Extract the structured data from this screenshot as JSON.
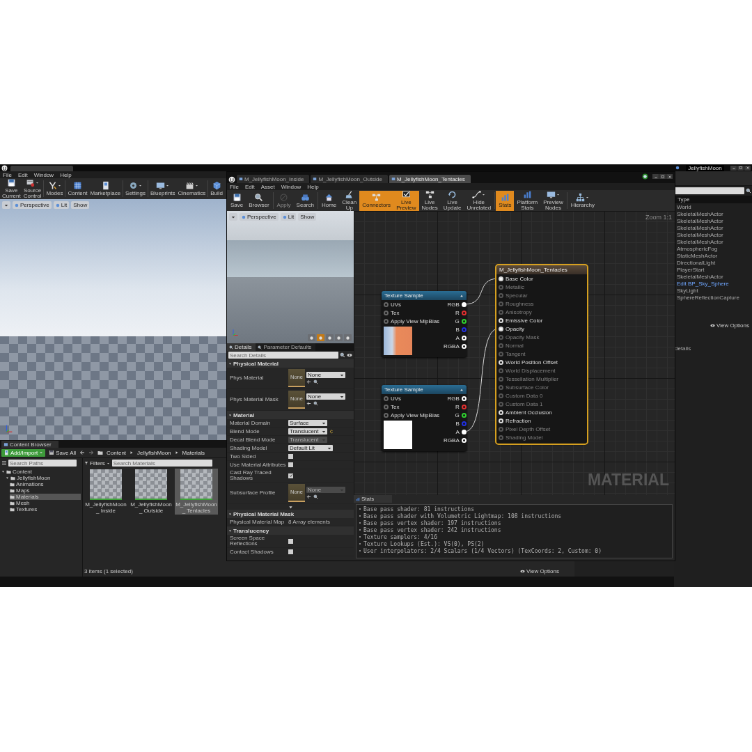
{
  "main_window": {
    "menu": [
      "File",
      "Edit",
      "Window",
      "Help"
    ],
    "toolbar": [
      {
        "label": "Save Current",
        "dropdown": false
      },
      {
        "label": "Source Control",
        "dropdown": true
      },
      {
        "label": "Modes",
        "dropdown": true
      },
      {
        "label": "Content",
        "dropdown": false
      },
      {
        "label": "Marketplace",
        "dropdown": false
      },
      {
        "label": "Settings",
        "dropdown": true
      },
      {
        "label": "Blueprints",
        "dropdown": true
      },
      {
        "label": "Cinematics",
        "dropdown": true
      },
      {
        "label": "Build",
        "dropdown": false
      }
    ],
    "viewport": {
      "view_mode": "Perspective",
      "lighting": "Lit",
      "show": "Show"
    }
  },
  "content_browser": {
    "tab": "Content Browser",
    "add_button": "Add/Import",
    "save_all": "Save All",
    "path": [
      "Content",
      "JellyfishMoon",
      "Materials"
    ],
    "search_paths_placeholder": "Search Paths",
    "tree": [
      {
        "label": "Content",
        "expanded": true,
        "selected": false,
        "children": [
          {
            "label": "JellyfishMoon",
            "expanded": true,
            "selected": false,
            "children": [
              {
                "label": "Animations",
                "selected": false
              },
              {
                "label": "Maps",
                "selected": false
              },
              {
                "label": "Materials",
                "selected": true
              },
              {
                "label": "Mesh",
                "selected": false
              },
              {
                "label": "Textures",
                "selected": false
              }
            ]
          }
        ]
      }
    ],
    "filters": "Filters",
    "search_placeholder": "Search Materials",
    "assets": [
      {
        "name": "M_JellyfishMoon_ Inside",
        "selected": false
      },
      {
        "name": "M_JellyfishMoon_ Outside",
        "selected": false
      },
      {
        "name": "M_JellyfishMoon_ Tentacles",
        "selected": true
      }
    ],
    "status": "3 items (1 selected)",
    "view_options": "View Options"
  },
  "outliner": {
    "tab": "JellyfishMoon",
    "column": "Type",
    "items": [
      {
        "label": "World",
        "kind": "plain"
      },
      {
        "label": "SkeletalMeshActor",
        "kind": "plain"
      },
      {
        "label": "SkeletalMeshActor",
        "kind": "plain"
      },
      {
        "label": "SkeletalMeshActor",
        "kind": "plain"
      },
      {
        "label": "SkeletalMeshActor",
        "kind": "plain"
      },
      {
        "label": "SkeletalMeshActor",
        "kind": "plain"
      },
      {
        "label": "AtmosphericFog",
        "kind": "plain"
      },
      {
        "label": "StaticMeshActor",
        "kind": "plain"
      },
      {
        "label": "DirectionalLight",
        "kind": "plain"
      },
      {
        "label": "PlayerStart",
        "kind": "plain"
      },
      {
        "label": "SkeletalMeshActor",
        "kind": "plain"
      },
      {
        "label": "Edit BP_Sky_Sphere",
        "kind": "link"
      },
      {
        "label": "SkyLight",
        "kind": "plain"
      },
      {
        "label": "SphereReflectionCapture",
        "kind": "plain"
      }
    ],
    "view_options": "View Options"
  },
  "details_panel": {
    "hint": "details"
  },
  "material_editor": {
    "tabs": [
      {
        "label": "M_JellyfishMoon_Inside",
        "selected": false
      },
      {
        "label": "M_JellyfishMoon_Outside",
        "selected": false
      },
      {
        "label": "M_JellyfishMoon_Tentacles",
        "selected": true
      }
    ],
    "menu": [
      "File",
      "Edit",
      "Asset",
      "Window",
      "Help"
    ],
    "toolbar": [
      {
        "label": "Save",
        "active": false,
        "disabled": false,
        "dropdown": false
      },
      {
        "label": "Browser",
        "active": false,
        "disabled": false,
        "dropdown": false
      },
      {
        "label": "Apply",
        "active": false,
        "disabled": true,
        "dropdown": false
      },
      {
        "label": "Search",
        "active": false,
        "disabled": false,
        "dropdown": false
      },
      {
        "label": "Home",
        "active": false,
        "disabled": false,
        "dropdown": false
      },
      {
        "label": "Clean Up",
        "active": false,
        "disabled": false,
        "dropdown": false
      },
      {
        "label": "Connectors",
        "active": true,
        "disabled": false,
        "dropdown": false
      },
      {
        "label": "Live Preview",
        "active": true,
        "disabled": false,
        "dropdown": false
      },
      {
        "label": "Live Nodes",
        "active": false,
        "disabled": false,
        "dropdown": false
      },
      {
        "label": "Live Update",
        "active": false,
        "disabled": false,
        "dropdown": false
      },
      {
        "label": "Hide Unrelated",
        "active": false,
        "disabled": false,
        "dropdown": true
      },
      {
        "label": "Stats",
        "active": true,
        "disabled": false,
        "dropdown": false
      },
      {
        "label": "Platform Stats",
        "active": false,
        "disabled": false,
        "dropdown": false
      },
      {
        "label": "Preview Nodes",
        "active": false,
        "disabled": false,
        "dropdown": true
      },
      {
        "label": "Hierarchy",
        "active": false,
        "disabled": false,
        "dropdown": true
      }
    ],
    "preview": {
      "view_mode": "Perspective",
      "lighting": "Lit",
      "show": "Show"
    },
    "details": {
      "tabs": [
        {
          "label": "Details",
          "selected": true
        },
        {
          "label": "Parameter Defaults",
          "selected": false
        }
      ],
      "search_placeholder": "Search Details",
      "sections": [
        {
          "title": "Physical Material",
          "rows": [
            {
              "kind": "asset",
              "label": "Phys Material",
              "thumb": "None",
              "value": "None",
              "disabled": false
            },
            {
              "kind": "asset",
              "label": "Phys Material Mask",
              "thumb": "None",
              "value": "None",
              "disabled": false
            }
          ]
        },
        {
          "title": "Material",
          "rows": [
            {
              "kind": "combo",
              "label": "Material Domain",
              "value": "Surface",
              "disabled": false,
              "reset": false
            },
            {
              "kind": "combo",
              "label": "Blend Mode",
              "value": "Translucent",
              "disabled": false,
              "reset": true
            },
            {
              "kind": "combo",
              "label": "Decal Blend Mode",
              "value": "Translucent",
              "disabled": true,
              "reset": false
            },
            {
              "kind": "combo",
              "label": "Shading Model",
              "value": "Default Lit",
              "disabled": false,
              "reset": false
            },
            {
              "kind": "check",
              "label": "Two Sided",
              "checked": false
            },
            {
              "kind": "check",
              "label": "Use Material Attributes",
              "checked": false
            },
            {
              "kind": "check",
              "label": "Cast Ray Traced Shadows",
              "checked": true
            },
            {
              "kind": "asset",
              "label": "Subsurface Profile",
              "thumb": "None",
              "value": "None",
              "disabled": true
            },
            {
              "kind": "advanced"
            }
          ]
        },
        {
          "title": "Physical Material Mask",
          "rows": [
            {
              "kind": "array",
              "label": "Physical Material Map",
              "value": "8 Array elements"
            }
          ]
        },
        {
          "title": "Translucency",
          "rows": [
            {
              "kind": "check",
              "label": "Screen Space Reflections",
              "checked": false
            },
            {
              "kind": "check",
              "label": "Contact Shadows",
              "checked": false
            }
          ]
        }
      ]
    },
    "graph": {
      "zoom": "Zoom 1:1",
      "watermark": "MATERIAL",
      "nodes": [
        {
          "kind": "texture",
          "title": "Texture Sample",
          "selected": false,
          "preview": {
            "kind": "image"
          },
          "inputs": [
            "UVs",
            "Tex",
            "Apply View MipBias"
          ],
          "outputs": [
            {
              "label": "RGB",
              "color": "#ffffff",
              "connected": true
            },
            {
              "label": "R",
              "color": "#e03030",
              "connected": false
            },
            {
              "label": "G",
              "color": "#30d030",
              "connected": false
            },
            {
              "label": "B",
              "color": "#2030e0",
              "connected": false
            },
            {
              "label": "A",
              "color": "#ffffff",
              "connected": false
            },
            {
              "label": "RGBA",
              "color": "#ffffff",
              "connected": false
            }
          ]
        },
        {
          "kind": "texture",
          "title": "Texture Sample",
          "selected": false,
          "preview": {
            "kind": "white"
          },
          "inputs": [
            "UVs",
            "Tex",
            "Apply View MipBias"
          ],
          "outputs": [
            {
              "label": "RGB",
              "color": "#ffffff",
              "connected": false
            },
            {
              "label": "R",
              "color": "#e03030",
              "connected": false
            },
            {
              "label": "G",
              "color": "#30d030",
              "connected": false
            },
            {
              "label": "B",
              "color": "#2030e0",
              "connected": false
            },
            {
              "label": "A",
              "color": "#ffffff",
              "connected": true
            },
            {
              "label": "RGBA",
              "color": "#ffffff",
              "connected": false
            }
          ]
        },
        {
          "kind": "result",
          "title": "M_JellyfishMoon_Tentacles",
          "selected": true,
          "pins": [
            {
              "label": "Base Color",
              "enabled": true,
              "connected": true
            },
            {
              "label": "Metallic",
              "enabled": false,
              "connected": false
            },
            {
              "label": "Specular",
              "enabled": false,
              "connected": false
            },
            {
              "label": "Roughness",
              "enabled": false,
              "connected": false
            },
            {
              "label": "Anisotropy",
              "enabled": false,
              "connected": false
            },
            {
              "label": "Emissive Color",
              "enabled": true,
              "connected": false
            },
            {
              "label": "Opacity",
              "enabled": true,
              "connected": true
            },
            {
              "label": "Opacity Mask",
              "enabled": false,
              "connected": false
            },
            {
              "label": "Normal",
              "enabled": false,
              "connected": false
            },
            {
              "label": "Tangent",
              "enabled": false,
              "connected": false
            },
            {
              "label": "World Position Offset",
              "enabled": true,
              "connected": false
            },
            {
              "label": "World Displacement",
              "enabled": false,
              "connected": false
            },
            {
              "label": "Tessellation Multiplier",
              "enabled": false,
              "connected": false
            },
            {
              "label": "Subsurface Color",
              "enabled": false,
              "connected": false
            },
            {
              "label": "Custom Data 0",
              "enabled": false,
              "connected": false
            },
            {
              "label": "Custom Data 1",
              "enabled": false,
              "connected": false
            },
            {
              "label": "Ambient Occlusion",
              "enabled": true,
              "connected": false
            },
            {
              "label": "Refraction",
              "enabled": true,
              "connected": false
            },
            {
              "label": "Pixel Depth Offset",
              "enabled": false,
              "connected": false
            },
            {
              "label": "Shading Model",
              "enabled": false,
              "connected": false
            }
          ]
        }
      ]
    },
    "stats": {
      "tab": "Stats",
      "lines": [
        "Base pass shader: 81 instructions",
        "Base pass shader with Volumetric Lightmap: 108 instructions",
        "Base pass vertex shader: 197 instructions",
        "Base pass vertex shader: 242 instructions",
        "Texture samplers: 4/16",
        "Texture Lookups (Est.): VS(0), PS(2)",
        "User interpolators: 2/4 Scalars (1/4 Vectors) (TexCoords: 2, Custom: 0)"
      ]
    }
  }
}
